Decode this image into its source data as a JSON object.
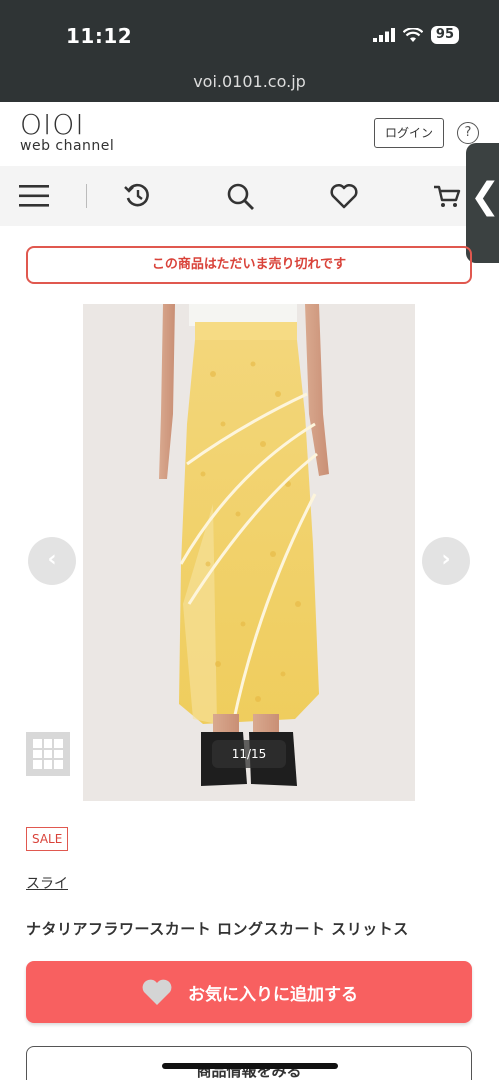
{
  "status_bar": {
    "time": "11:12",
    "battery": "95"
  },
  "browser": {
    "url": "voi.0101.co.jp"
  },
  "header": {
    "logo_mark": "OIOI",
    "logo_sub": "web channel",
    "login_label": "ログイン",
    "help_label": "?"
  },
  "nav": {
    "icons": [
      "menu-icon",
      "history-icon",
      "search-icon",
      "heart-icon",
      "cart-icon"
    ],
    "side_tab_glyph": "❮"
  },
  "product": {
    "soldout_text": "この商品はただいま売り切れです",
    "image_counter": "11/15",
    "prev_glyph": "‹",
    "next_glyph": "›",
    "sale_label": "SALE",
    "brand": "スライ",
    "name": "ナタリアフラワースカート ロングスカート スリットス",
    "favorite_label": "お気に入りに追加する",
    "info_label": "商品情報をみる"
  },
  "colors": {
    "accent_red": "#f86060",
    "sold_out_red": "#d9433a",
    "status_bar_bg": "#2f3435"
  }
}
